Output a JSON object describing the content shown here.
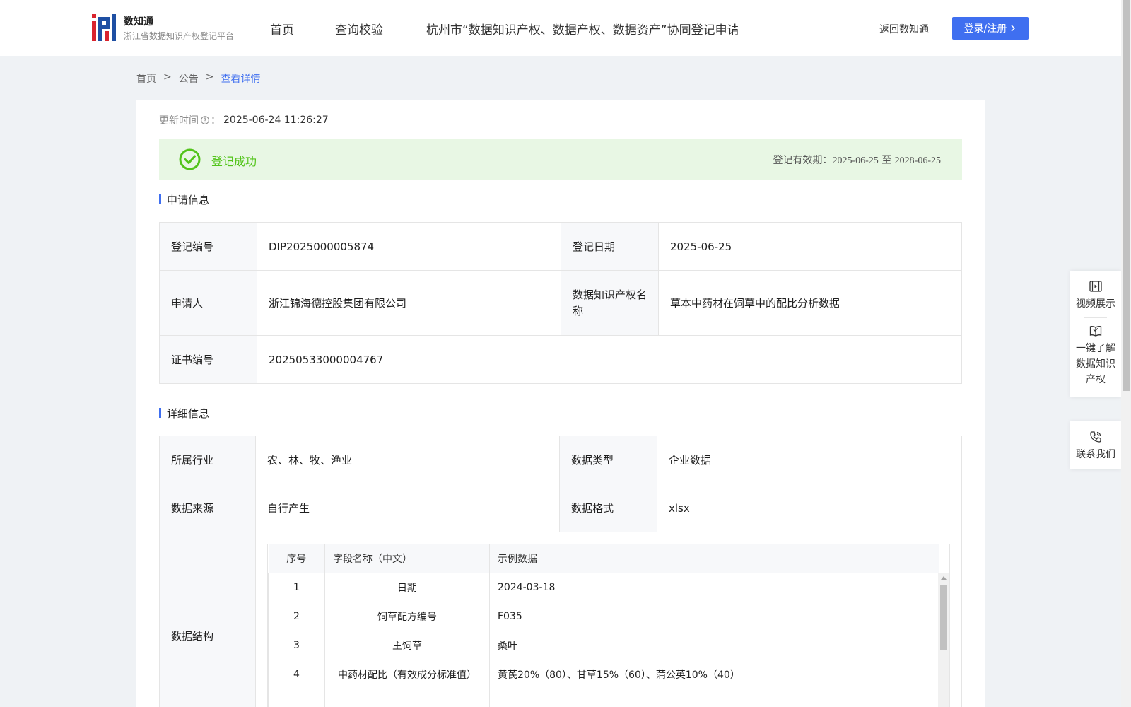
{
  "header": {
    "brand_name": "数知通",
    "brand_sub": "浙江省数据知识产权登记平台",
    "nav": [
      "首页",
      "查询校验",
      "杭州市“数据知识产权、数据产权、数据资产”协同登记申请"
    ],
    "back_link": "返回数知通",
    "login": "登录/注册"
  },
  "breadcrumb": {
    "home": "首页",
    "sep1": ">",
    "notice": "公告",
    "sep2": ">",
    "current": "查看详情"
  },
  "update": {
    "label": "更新时间",
    "colon": "：",
    "value": "2025-06-24 11:26:27"
  },
  "status": {
    "text": "登记成功",
    "validity_label": "登记有效期：",
    "validity_from": "2025-06-25",
    "validity_to_word": "至",
    "validity_to": "2028-06-25",
    "color": "#52c41a"
  },
  "apply_section": {
    "title": "申请信息",
    "reg_no_label": "登记编号",
    "reg_no": "DIP2025000005874",
    "reg_date_label": "登记日期",
    "reg_date": "2025-06-25",
    "applicant_label": "申请人",
    "applicant": "浙江锦海德控股集团有限公司",
    "ip_name_label": "数据知识产权名称",
    "ip_name": "草本中药材在饲草中的配比分析数据",
    "cert_no_label": "证书编号",
    "cert_no": "20250533000004767"
  },
  "detail_section": {
    "title": "详细信息",
    "industry_label": "所属行业",
    "industry": "农、林、牧、渔业",
    "data_type_label": "数据类型",
    "data_type": "企业数据",
    "source_label": "数据来源",
    "source": "自行产生",
    "format_label": "数据格式",
    "format": "xlsx",
    "structure_label": "数据结构",
    "fields_headers": [
      "序号",
      "字段名称（中文）",
      "示例数据"
    ],
    "fields": [
      {
        "no": "1",
        "name": "日期",
        "sample": "2024-03-18"
      },
      {
        "no": "2",
        "name": "饲草配方编号",
        "sample": "F035"
      },
      {
        "no": "3",
        "name": "主饲草",
        "sample": "桑叶"
      },
      {
        "no": "4",
        "name": "中药材配比（有效成分标准值）",
        "sample": "黄芪20%（80）、甘草15%（60）、蒲公英10%（40）"
      }
    ]
  },
  "float_panel": {
    "video": "视频展示",
    "learn": "一键了解数据知识产权",
    "contact": "联系我们"
  },
  "colors": {
    "accent": "#3f6ff0",
    "success_bg": "#e8f7e4"
  }
}
